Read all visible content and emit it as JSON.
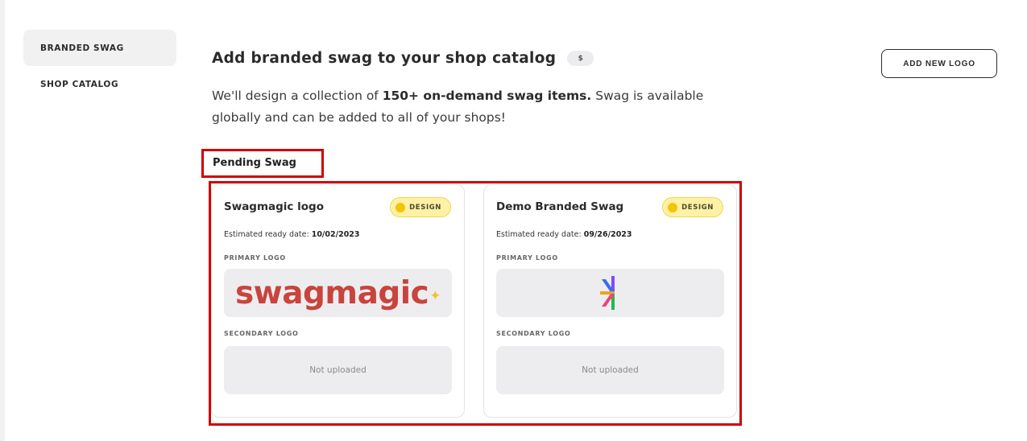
{
  "sidebar": {
    "items": [
      {
        "label": "BRANDED SWAG",
        "active": true
      },
      {
        "label": "SHOP CATALOG",
        "active": false
      }
    ]
  },
  "header": {
    "title": "Add branded swag to your shop catalog",
    "price_badge": "$",
    "add_logo_label": "ADD NEW LOGO",
    "description_prefix": "We'll design a collection of ",
    "description_bold": "150+ on-demand swag items.",
    "description_suffix": " Swag is available globally and can be added to all of your shops!"
  },
  "pending": {
    "section_label": "Pending Swag",
    "cards": [
      {
        "title": "Swagmagic logo",
        "status": "DESIGN",
        "ready_label": "Estimated ready date:",
        "ready_date": "10/02/2023",
        "primary_label": "PRIMARY LOGO",
        "primary_logo_text": "swagmagic",
        "primary_logo_sparkle": "✦",
        "secondary_label": "SECONDARY LOGO",
        "secondary_value": "Not uploaded"
      },
      {
        "title": "Demo Branded Swag",
        "status": "DESIGN",
        "ready_label": "Estimated ready date:",
        "ready_date": "09/26/2023",
        "primary_label": "PRIMARY LOGO",
        "secondary_label": "SECONDARY LOGO",
        "secondary_value": "Not uploaded"
      }
    ]
  },
  "colors": {
    "highlight_red": "#d00000",
    "badge_yellow": "#fff1a6",
    "badge_dot": "#f5c400",
    "swagmagic_red": "#c8443c"
  }
}
